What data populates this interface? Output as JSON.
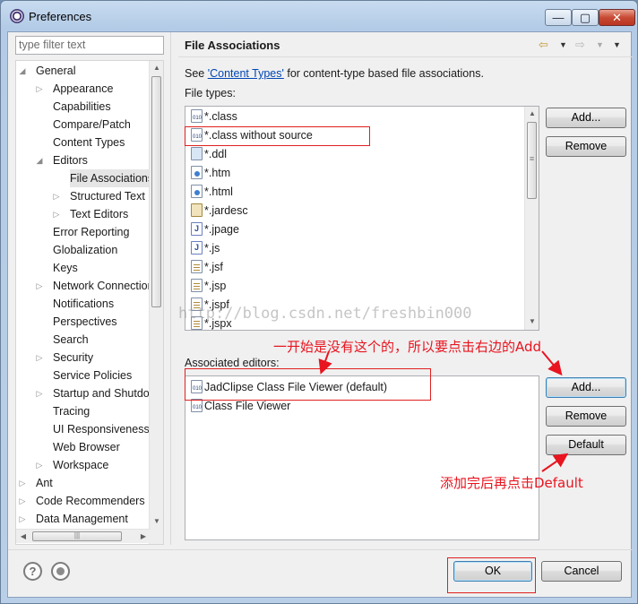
{
  "window": {
    "title": "Preferences",
    "min_glyph": "—",
    "max_glyph": "▢",
    "close_glyph": "✕"
  },
  "filter": {
    "placeholder": "type filter text"
  },
  "tree": [
    {
      "label": "General",
      "arrow": "◢"
    },
    {
      "label": "Appearance",
      "arrow": "▷"
    },
    {
      "label": "Capabilities",
      "arrow": ""
    },
    {
      "label": "Compare/Patch",
      "arrow": ""
    },
    {
      "label": "Content Types",
      "arrow": ""
    },
    {
      "label": "Editors",
      "arrow": "◢"
    },
    {
      "label": "File Associations",
      "arrow": ""
    },
    {
      "label": "Structured Text",
      "arrow": "▷"
    },
    {
      "label": "Text Editors",
      "arrow": "▷"
    },
    {
      "label": "Error Reporting",
      "arrow": ""
    },
    {
      "label": "Globalization",
      "arrow": ""
    },
    {
      "label": "Keys",
      "arrow": ""
    },
    {
      "label": "Network Connections",
      "arrow": "▷"
    },
    {
      "label": "Notifications",
      "arrow": ""
    },
    {
      "label": "Perspectives",
      "arrow": ""
    },
    {
      "label": "Search",
      "arrow": ""
    },
    {
      "label": "Security",
      "arrow": "▷"
    },
    {
      "label": "Service Policies",
      "arrow": ""
    },
    {
      "label": "Startup and Shutdown",
      "arrow": "▷"
    },
    {
      "label": "Tracing",
      "arrow": ""
    },
    {
      "label": "UI Responsiveness",
      "arrow": ""
    },
    {
      "label": "Web Browser",
      "arrow": ""
    },
    {
      "label": "Workspace",
      "arrow": "▷"
    },
    {
      "label": "Ant",
      "arrow": "▷"
    },
    {
      "label": "Code Recommenders",
      "arrow": "▷"
    },
    {
      "label": "Data Management",
      "arrow": "▷"
    }
  ],
  "page": {
    "title": "File Associations",
    "see_prefix": "See ",
    "see_link": "'Content Types'",
    "see_suffix": " for content-type based file associations.",
    "file_types_label": "File types:",
    "file_types": [
      "*.class",
      "*.class without source",
      "*.ddl",
      "*.htm",
      "*.html",
      "*.jardesc",
      "*.jpage",
      "*.js",
      "*.jsf",
      "*.jsp",
      "*.jspf",
      "*.jspx"
    ],
    "file_type_icons": [
      "bin",
      "bin",
      "ddl",
      "web",
      "web",
      "jar",
      "java",
      "java",
      "doc",
      "doc",
      "doc",
      "doc"
    ],
    "associated_label": "Associated editors:",
    "editors": [
      "JadClipse Class File Viewer (default)",
      "Class File Viewer"
    ],
    "add_label": "Add...",
    "remove_label": "Remove",
    "default_label": "Default"
  },
  "nav": {
    "back": "⇦",
    "forward": "⇨",
    "dropdown": "▼",
    "menu": "▼"
  },
  "footer": {
    "help": "?",
    "ok_label": "OK",
    "cancel_label": "Cancel"
  },
  "annotations": {
    "note1": "一开始是没有这个的，所以要点击右边的Add",
    "note2": "添加完后再点击Default",
    "color": "#e8141f"
  },
  "watermark": "http://blog.csdn.net/freshbin000",
  "scroll": {
    "up": "▲",
    "down": "▼",
    "left": "◀",
    "right": "▶",
    "grip": "≡",
    "hgrip": "|||"
  }
}
